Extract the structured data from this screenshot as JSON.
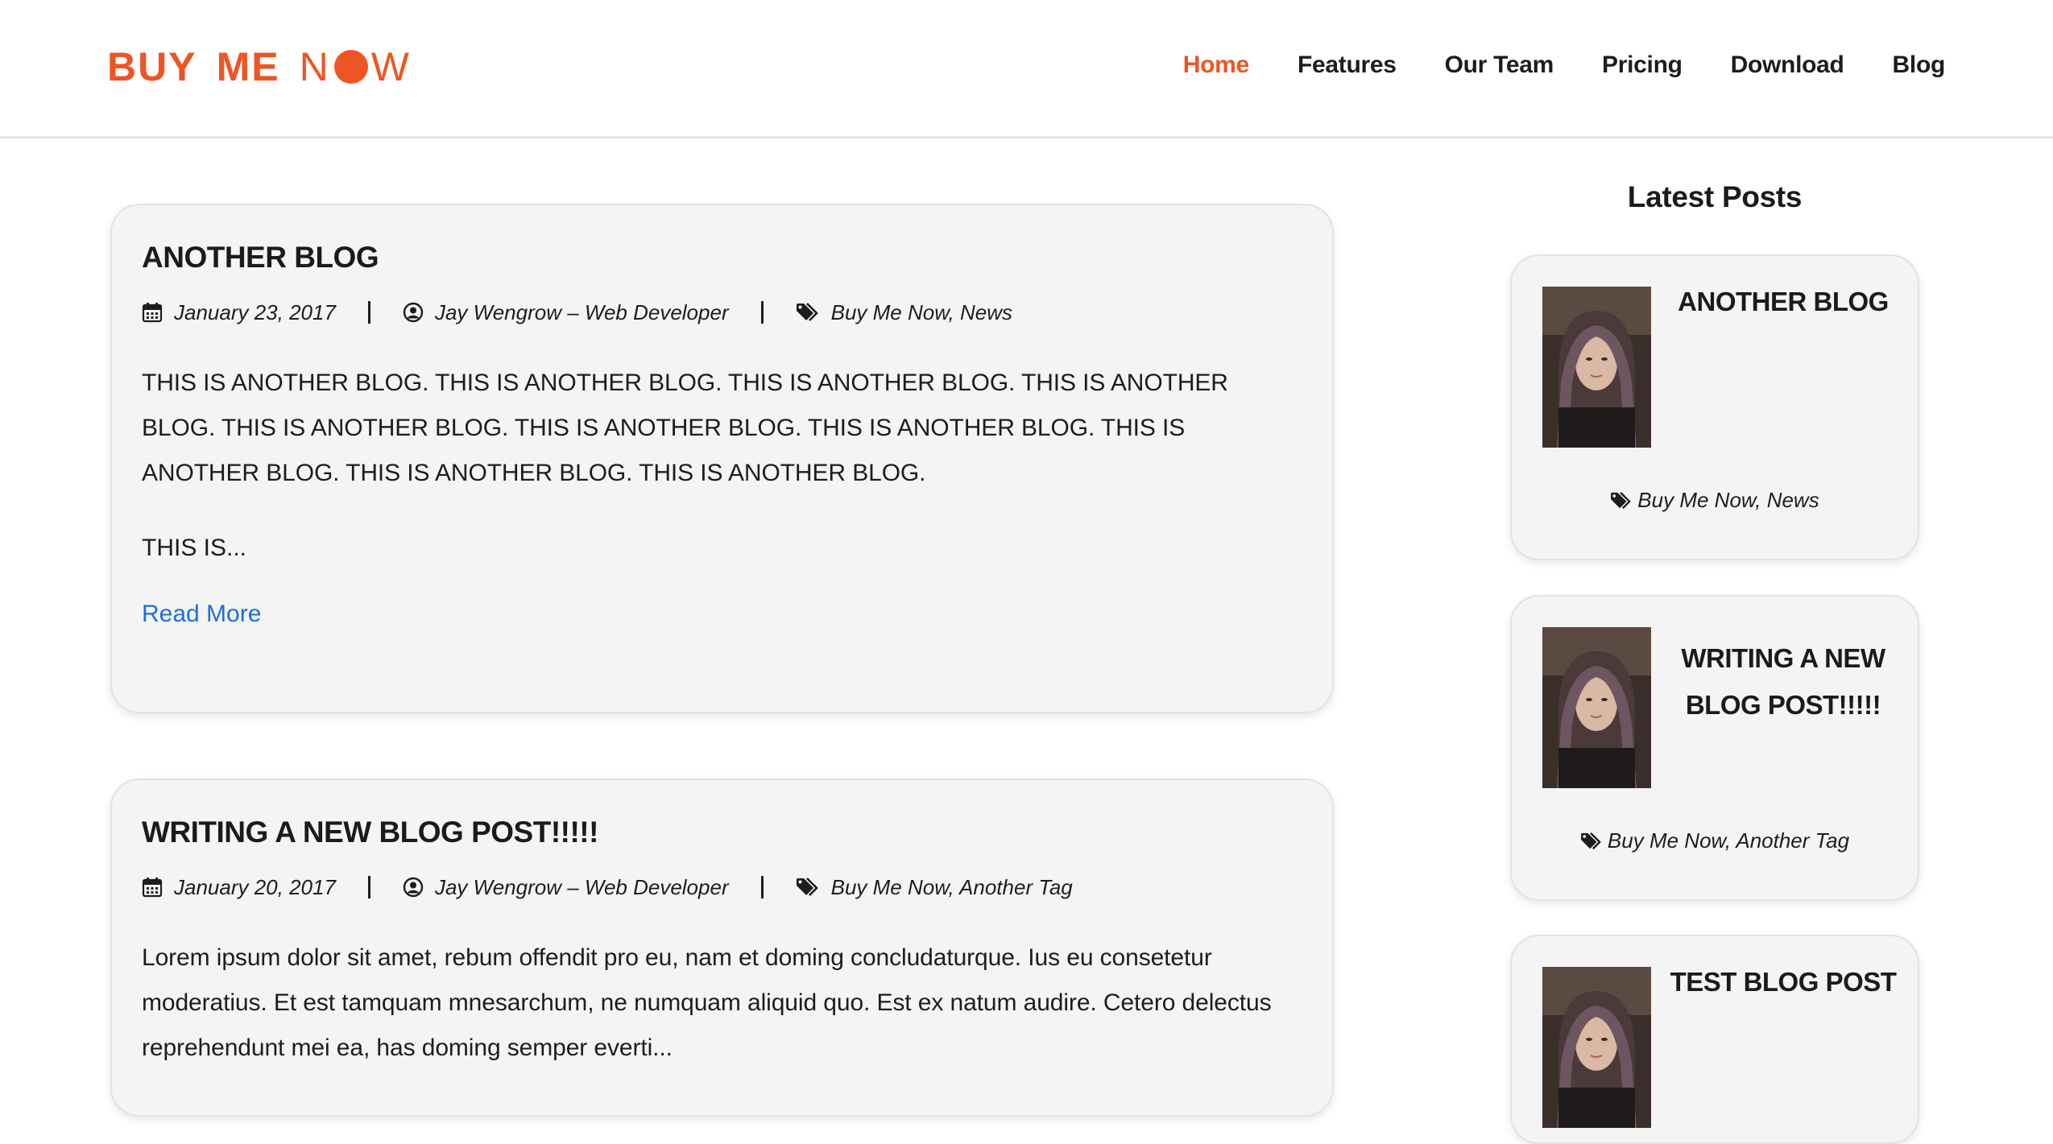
{
  "brand": {
    "logo_part1": "BUY",
    "logo_part2": "ME",
    "logo_part3_n": "N",
    "logo_part3_w": "W",
    "color": "#ee5524"
  },
  "nav": {
    "items": [
      {
        "label": "Home",
        "active": true
      },
      {
        "label": "Features",
        "active": false
      },
      {
        "label": "Our Team",
        "active": false
      },
      {
        "label": "Pricing",
        "active": false
      },
      {
        "label": "Download",
        "active": false
      },
      {
        "label": "Blog",
        "active": false
      }
    ]
  },
  "posts": [
    {
      "title": "ANOTHER BLOG",
      "date": "January 23, 2017",
      "author": "Jay Wengrow – Web Developer",
      "tags": "Buy Me Now, News",
      "excerpt": "THIS IS ANOTHER BLOG. THIS IS ANOTHER BLOG. THIS IS ANOTHER BLOG. THIS IS ANOTHER BLOG. THIS IS ANOTHER BLOG. THIS IS ANOTHER BLOG. THIS IS ANOTHER BLOG. THIS IS ANOTHER BLOG. THIS IS ANOTHER BLOG. THIS IS ANOTHER BLOG.",
      "excerpt_more": "THIS IS...",
      "read_more": "Read More"
    },
    {
      "title": "WRITING A NEW BLOG POST!!!!!",
      "date": "January 20, 2017",
      "author": "Jay Wengrow – Web Developer",
      "tags": "Buy Me Now, Another Tag",
      "excerpt": "Lorem ipsum dolor sit amet, rebum offendit pro eu, nam et doming concludaturque. Ius eu consetetur moderatius. Et est tamquam mnesarchum, ne numquam aliquid quo. Est ex natum audire. Cetero delectus reprehendunt mei ea, has doming semper everti..."
    }
  ],
  "sidebar": {
    "title": "Latest Posts",
    "posts": [
      {
        "title": "ANOTHER BLOG",
        "tags": "Buy Me Now, News"
      },
      {
        "title": "WRITING A NEW BLOG POST!!!!!",
        "tags": "Buy Me Now, Another Tag"
      },
      {
        "title": "TEST BLOG POST"
      }
    ]
  },
  "colors": {
    "accent": "#ee5524",
    "link": "#1a6fde",
    "card_bg": "#f4f4f4",
    "text": "#1d1d1d"
  },
  "icons": [
    "calendar-icon",
    "user-circle-icon",
    "tags-icon",
    "portrait-thumbnail"
  ]
}
